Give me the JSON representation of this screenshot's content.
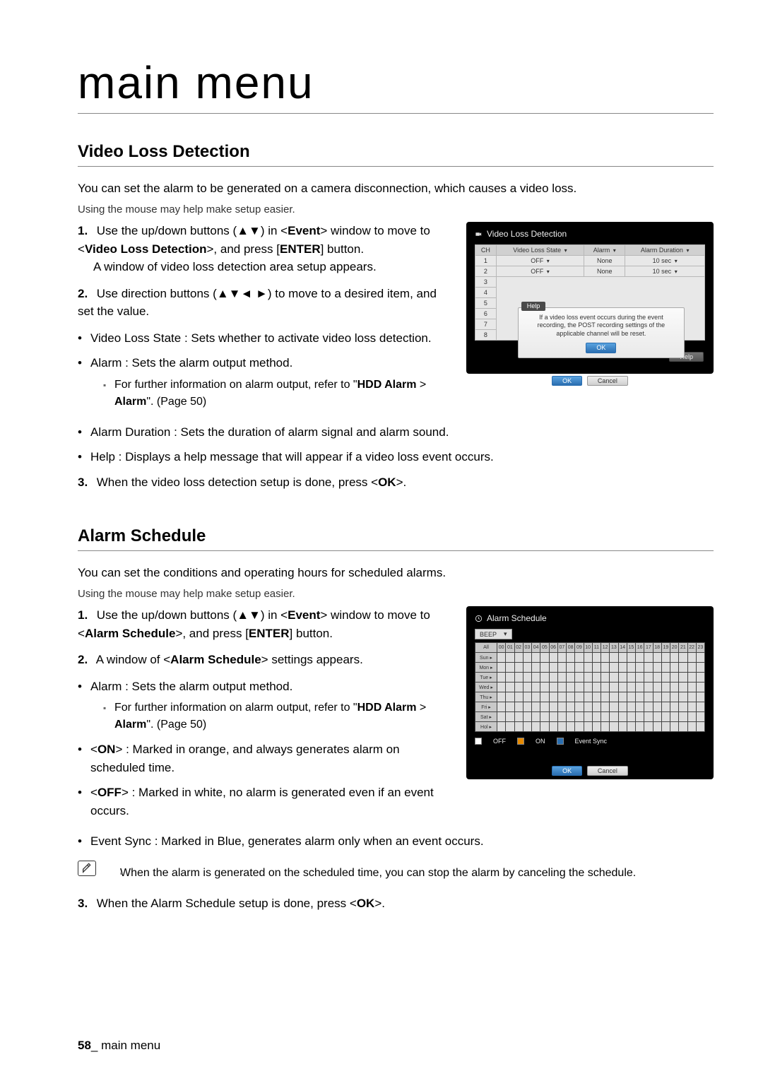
{
  "page_title": "main menu",
  "footer": {
    "page_num": "58",
    "label": "_ main menu"
  },
  "video_loss": {
    "heading": "Video Loss Detection",
    "intro1": "You can set the alarm to be generated on a camera disconnection, which causes a video loss.",
    "intro2": "Using the mouse may help make setup easier.",
    "step1_a": "Use the up/down buttons (▲▼) in <",
    "step1_b": "Event",
    "step1_c": "> window to move to <",
    "step1_d": "Video Loss Detection",
    "step1_e": ">, and press [",
    "step1_f": "ENTER",
    "step1_g": "] button.",
    "step1_line2": "A window of video loss detection area setup appears.",
    "step2": "Use direction buttons (▲▼◄ ►) to move to a desired item, and set the value.",
    "b1": "Video Loss State : Sets whether to activate video loss detection.",
    "b2": "Alarm : Sets the alarm output method.",
    "b2_sub_a": "For further information on alarm output, refer to \"",
    "b2_sub_b": "HDD Alarm",
    "b2_sub_c": " > ",
    "b2_sub_d": "Alarm",
    "b2_sub_e": "\". (Page 50)",
    "b3": "Alarm Duration : Sets the duration of alarm signal and alarm sound.",
    "b4": "Help : Displays a help message that will appear if a video loss event occurs.",
    "step3_a": "When the video loss detection setup is done, press <",
    "step3_b": "OK",
    "step3_c": ">."
  },
  "video_loss_shot": {
    "title": "Video Loss Detection",
    "cols": {
      "ch": "CH",
      "state": "Video Loss State",
      "alarm": "Alarm",
      "duration": "Alarm Duration"
    },
    "arrow": "▾",
    "rows": [
      {
        "ch": "1",
        "state": "OFF",
        "alarm": "None",
        "duration": "10 sec"
      },
      {
        "ch": "2",
        "state": "OFF",
        "alarm": "None",
        "duration": "10 sec"
      },
      {
        "ch": "3"
      },
      {
        "ch": "4"
      },
      {
        "ch": "5"
      },
      {
        "ch": "6"
      },
      {
        "ch": "7"
      },
      {
        "ch": "8"
      }
    ],
    "help_label": "Help",
    "help_text": "If a video loss event occurs during the event recording, the POST recording settings of the applicable channel will be reset.",
    "btn_ok": "OK",
    "btn_cancel": "Cancel",
    "btn_help": "Help"
  },
  "alarm_sched": {
    "heading": "Alarm Schedule",
    "intro1": "You can set the conditions and operating hours for scheduled alarms.",
    "intro2": "Using the mouse may help make setup easier.",
    "step1_a": "Use the up/down buttons (▲▼) in <",
    "step1_b": "Event",
    "step1_c": "> window to move to <",
    "step1_d": "Alarm Schedule",
    "step1_e": ">, and press [",
    "step1_f": "ENTER",
    "step1_g": "] button.",
    "step2_a": "A window of <",
    "step2_b": "Alarm Schedule",
    "step2_c": "> settings appears.",
    "b1": "Alarm : Sets the alarm output method.",
    "b1_sub_a": "For further information on alarm output, refer to \"",
    "b1_sub_b": "HDD Alarm",
    "b1_sub_c": " > ",
    "b1_sub_d": "Alarm",
    "b1_sub_e": "\". (Page 50)",
    "b2_a": "<",
    "b2_b": "ON",
    "b2_c": "> : Marked in orange, and always generates alarm on scheduled time.",
    "b3_a": "<",
    "b3_b": "OFF",
    "b3_c": "> : Marked in white, no alarm is generated even if an event occurs.",
    "b4": "Event Sync : Marked in Blue, generates alarm only when an event occurs.",
    "note": "When the alarm is generated on the scheduled time, you can stop the alarm by canceling the schedule.",
    "step3_a": "When the Alarm Schedule setup is done, press <",
    "step3_b": "OK",
    "step3_c": ">."
  },
  "alarm_shot": {
    "title": "Alarm Schedule",
    "select": "BEEP",
    "arrow": "▾",
    "row_hdr": "All",
    "hours": [
      "00",
      "01",
      "02",
      "03",
      "04",
      "05",
      "06",
      "07",
      "08",
      "09",
      "10",
      "11",
      "12",
      "13",
      "14",
      "15",
      "16",
      "17",
      "18",
      "19",
      "20",
      "21",
      "22",
      "23"
    ],
    "days": [
      "Sun",
      "Mon",
      "Tue",
      "Wed",
      "Thu",
      "Fri",
      "Sat",
      "Hol"
    ],
    "day_arrow": "▸",
    "legend_off": "OFF",
    "legend_on": "ON",
    "legend_ev": "Event Sync",
    "btn_ok": "OK",
    "btn_cancel": "Cancel"
  },
  "nums": {
    "n1": "1.",
    "n2": "2.",
    "n3": "3."
  }
}
